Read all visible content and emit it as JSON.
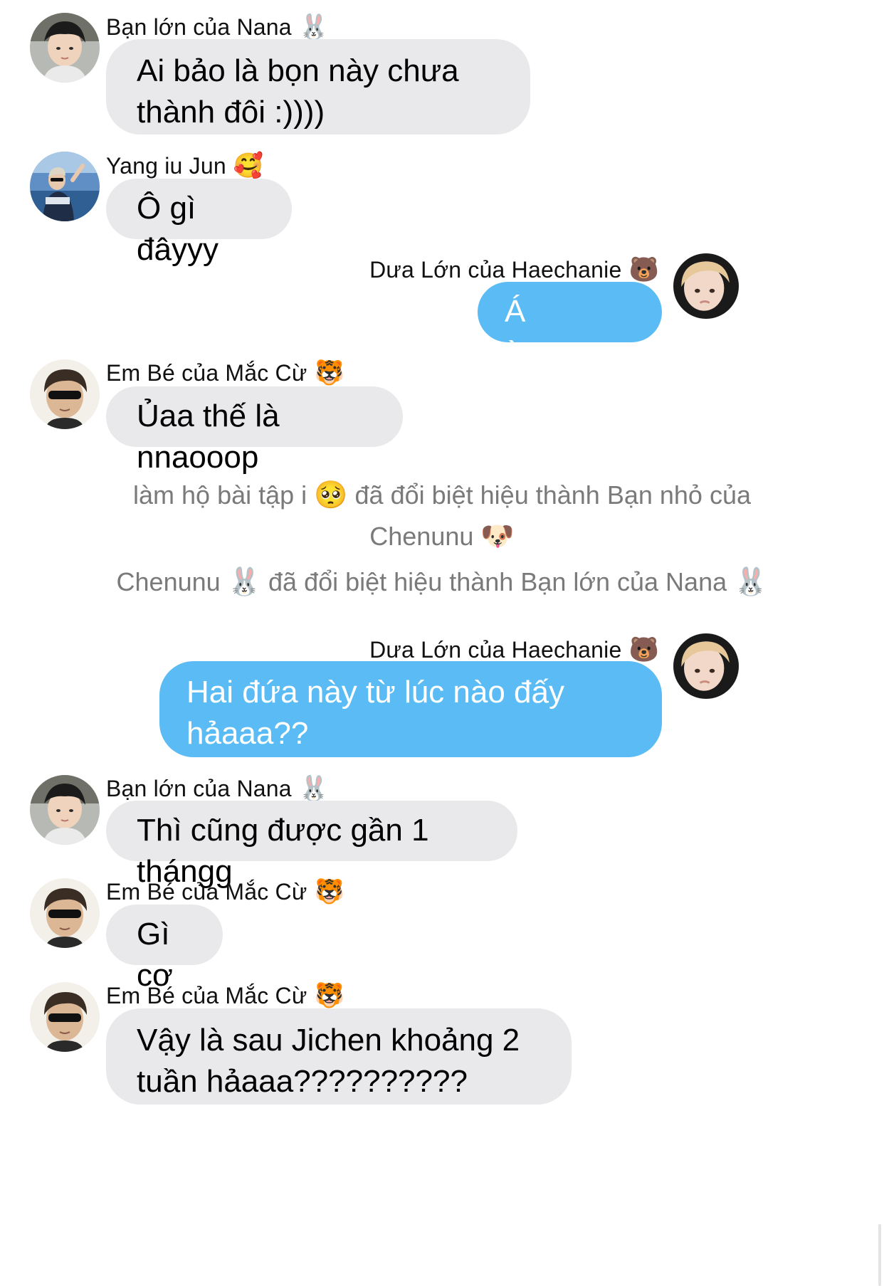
{
  "messages": [
    {
      "sender": "Bạn lớn của Nana",
      "sender_emoji": "🐰",
      "text": "Ai bảo là bọn này chưa thành đôi :))))",
      "direction": "incoming",
      "avatar": "avatar-nana"
    },
    {
      "sender": "Yang iu Jun",
      "sender_emoji": "🥰",
      "text": "Ô gì đâyyy",
      "direction": "incoming",
      "avatar": "avatar-yang"
    },
    {
      "sender": "Dưa Lớn của Haechanie",
      "sender_emoji": "🐻",
      "text": "Á àaaaaap",
      "direction": "outgoing",
      "avatar": "avatar-dua"
    },
    {
      "sender": "Em Bé của Mắc Cừ",
      "sender_emoji": "🐯",
      "text": "Ủaa thế là nnaooop",
      "direction": "incoming",
      "avatar": "avatar-embe"
    }
  ],
  "system_notices": [
    {
      "text_a": "làm hộ bài tập i",
      "emoji_a": "🥺",
      "text_b": "đã đổi biệt hiệu thành Bạn nhỏ của",
      "text_c": "Chenunu",
      "emoji_c": "🐶"
    },
    {
      "text_a": "Chenunu",
      "emoji_a": "🐰",
      "text_b": "đã đổi biệt hiệu thành Bạn lớn của Nana",
      "emoji_b": "🐰"
    }
  ],
  "messages2": [
    {
      "sender": "Dưa Lớn của Haechanie",
      "sender_emoji": "🐻",
      "text": "Hai đứa này từ lúc nào đấy hảaaa??",
      "text_emoji": "😳😳",
      "direction": "outgoing",
      "avatar": "avatar-dua"
    },
    {
      "sender": "Bạn lớn của Nana",
      "sender_emoji": "🐰",
      "text": "Thì cũng được gần 1 thángg",
      "direction": "incoming",
      "avatar": "avatar-nana"
    },
    {
      "sender": "Em Bé của Mắc Cừ",
      "sender_emoji": "🐯",
      "text": "Gì cơ",
      "direction": "incoming",
      "avatar": "avatar-embe"
    },
    {
      "sender": "Em Bé của Mắc Cừ",
      "sender_emoji": "🐯",
      "text": "Vậy là sau Jichen khoảng 2 tuần hảaaa??????????",
      "direction": "incoming",
      "avatar": "avatar-embe"
    }
  ],
  "colors": {
    "incoming_bubble": "#e9e9eb",
    "outgoing_bubble": "#5bbcf5",
    "system_text": "#7a7a7a"
  }
}
